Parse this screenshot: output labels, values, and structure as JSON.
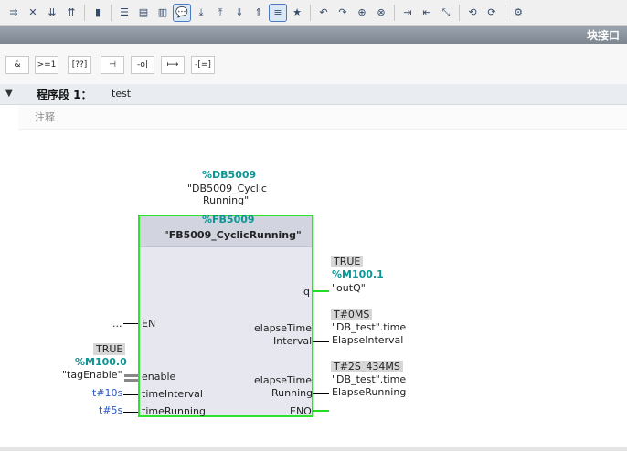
{
  "toolbar": {
    "icons": [
      "ladder-insert-icon",
      "ladder-delete-icon",
      "ladder-collapse-icon",
      "ladder-expand-icon",
      "monitor-icon",
      "network-left-icon",
      "network-open-icon",
      "network-close-icon",
      "comment-icon",
      "instance-down-icon",
      "instance-up-icon",
      "variable-down-icon",
      "variable-up-icon",
      "list-view-icon",
      "favorites-icon",
      "goto-prev-icon",
      "goto-next-icon",
      "goto-block-icon",
      "goto-symbol-icon",
      "indent-icon",
      "outdent-icon",
      "split-icon",
      "refresh-back-icon",
      "refresh-fwd-icon",
      "settings-icon"
    ]
  },
  "window": {
    "title": "块接口"
  },
  "palette": {
    "buttons": [
      "&",
      ">=1",
      "[??]",
      "⊣",
      "-o|",
      "⟼",
      "-[=]"
    ]
  },
  "network": {
    "label": "程序段 1：",
    "name": "test",
    "comment_placeholder": "注释"
  },
  "block": {
    "instance_address": "%DB5009",
    "instance_name_line1": "\"DB5009_Cyclic",
    "instance_name_line2": "Running\"",
    "fb_address": "%FB5009",
    "fb_name": "\"FB5009_CyclicRunning\"",
    "inputs": {
      "en": "EN",
      "en_wire": "...",
      "enable": "enable",
      "time_interval": "timeInterval",
      "time_running": "timeRunning"
    },
    "outputs": {
      "q": "q",
      "elapse_interval_line1": "elapseTime",
      "elapse_interval_line2": "Interval",
      "elapse_running_line1": "elapseTime",
      "elapse_running_line2": "Running",
      "eno": "ENO"
    },
    "enable_param": {
      "value": "TRUE",
      "address": "%M100.0",
      "tag": "\"tagEnable\""
    },
    "interval_value": "t#10s",
    "running_value": "t#5s",
    "q_param": {
      "value": "TRUE",
      "address": "%M100.1",
      "tag": "\"outQ\""
    },
    "interval_param": {
      "value": "T#0MS",
      "tag_line1": "\"DB_test\".time",
      "tag_line2": "ElapseInterval"
    },
    "running_param": {
      "value": "T#2S_434MS",
      "tag_line1": "\"DB_test\".time",
      "tag_line2": "ElapseRunning"
    }
  },
  "colors": {
    "accent_green": "#2ee32e",
    "address_teal": "#0e9494",
    "literal_blue": "#2a58c8"
  }
}
